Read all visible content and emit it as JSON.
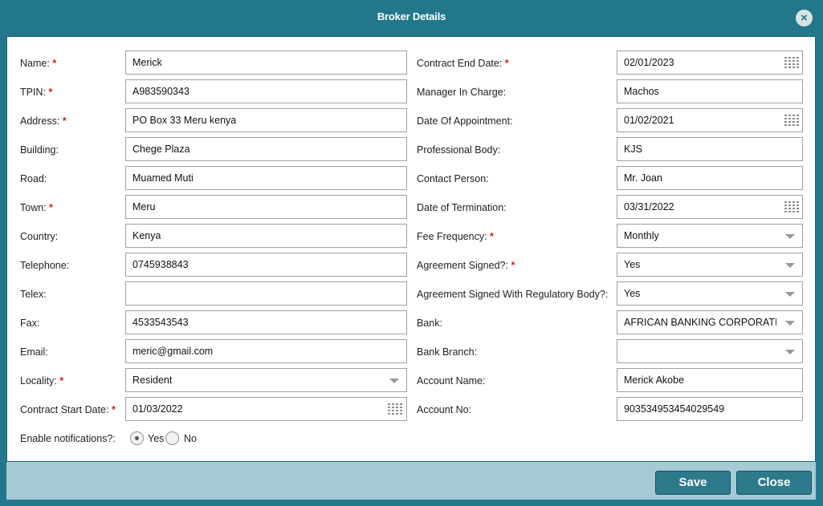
{
  "dialog": {
    "title": "Broker Details",
    "close_icon": "×"
  },
  "left": {
    "name": {
      "label": "Name:",
      "required": "*",
      "value": "Merick"
    },
    "tpin": {
      "label": "TPIN:",
      "required": "*",
      "value": "A983590343"
    },
    "address": {
      "label": "Address:",
      "required": "*",
      "value": "PO Box 33 Meru kenya"
    },
    "building": {
      "label": "Building:",
      "value": "Chege Plaza"
    },
    "road": {
      "label": "Road:",
      "value": "Muamed Muti"
    },
    "town": {
      "label": "Town:",
      "required": "*",
      "value": "Meru"
    },
    "country": {
      "label": "Country:",
      "value": "Kenya"
    },
    "telephone": {
      "label": "Telephone:",
      "value": "0745938843"
    },
    "telex": {
      "label": "Telex:",
      "value": ""
    },
    "fax": {
      "label": "Fax:",
      "value": "4533543543"
    },
    "email": {
      "label": "Email:",
      "value": "meric@gmail.com"
    },
    "locality": {
      "label": "Locality:",
      "required": "*",
      "value": "Resident"
    },
    "contract_start": {
      "label": "Contract Start Date:",
      "required": "*",
      "value": "01/03/2022"
    },
    "notifications": {
      "label": "Enable notifications?:",
      "yes": "Yes",
      "no": "No",
      "selected": "Yes"
    }
  },
  "right": {
    "contract_end": {
      "label": "Contract End Date:",
      "required": "*",
      "value": "02/01/2023"
    },
    "manager": {
      "label": "Manager In Charge:",
      "value": "Machos"
    },
    "appointment": {
      "label": "Date Of Appointment:",
      "value": "01/02/2021"
    },
    "prof_body": {
      "label": "Professional Body:",
      "value": "KJS"
    },
    "contact": {
      "label": "Contact Person:",
      "value": "Mr. Joan"
    },
    "termination": {
      "label": "Date of Termination:",
      "value": "03/31/2022"
    },
    "fee_freq": {
      "label": "Fee Frequency:",
      "required": "*",
      "value": "Monthly"
    },
    "agreement": {
      "label": "Agreement Signed?:",
      "required": "*",
      "value": "Yes"
    },
    "agreement_reg": {
      "label": "Agreement Signed With Regulatory Body?:",
      "value": "Yes"
    },
    "bank": {
      "label": "Bank:",
      "value": "AFRICAN BANKING CORPORATIC"
    },
    "branch": {
      "label": "Bank Branch:",
      "value": ""
    },
    "acc_name": {
      "label": "Account Name:",
      "value": "Merick Akobe"
    },
    "acc_no": {
      "label": "Account No:",
      "value": "903534953454029549"
    }
  },
  "footer": {
    "save_label": "Save",
    "close_label": "Close"
  },
  "icons": {
    "calendar": "calendar-icon",
    "dropdown": "chevron-down-icon",
    "close": "close-icon"
  },
  "colors": {
    "frame": "#22788a",
    "footer": "#a6cad3",
    "button": "#2d7a8c",
    "required": "#e01b1b"
  }
}
